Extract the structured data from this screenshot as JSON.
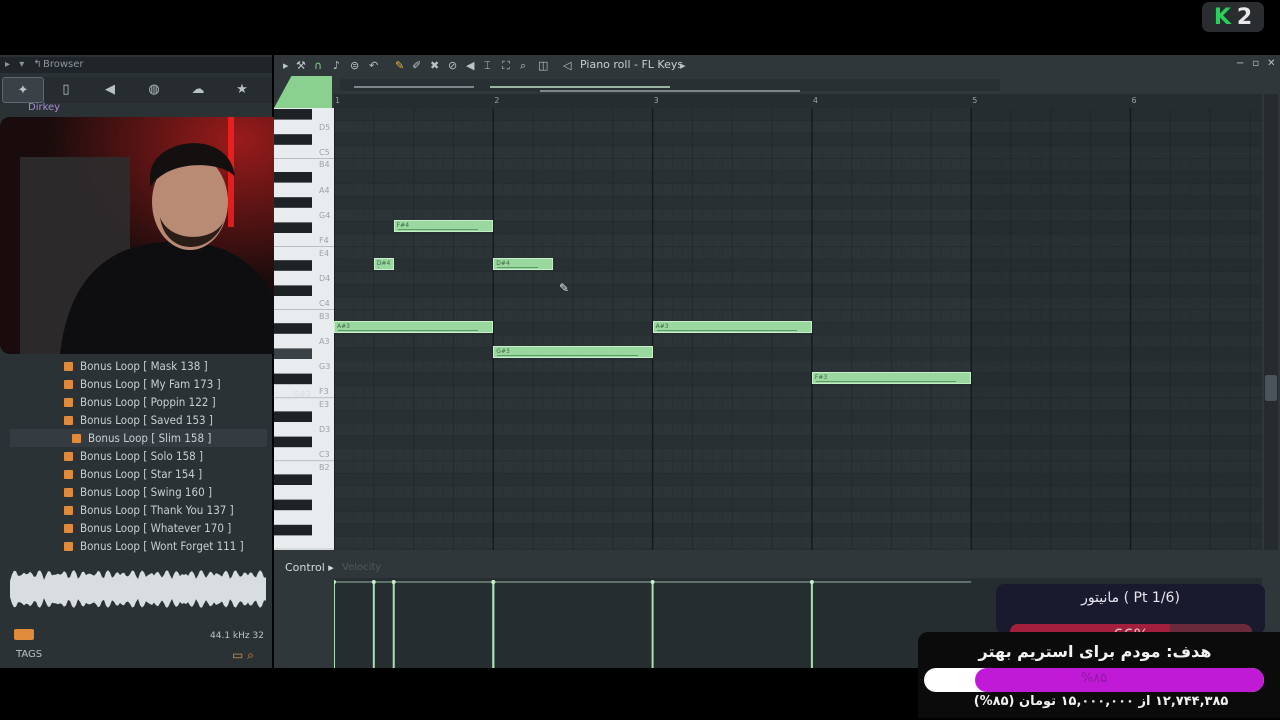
{
  "logo": {
    "k": "K",
    "two": "2"
  },
  "browser": {
    "title": "Browser",
    "tabs": [
      "all-icon",
      "file-icon",
      "speaker-icon",
      "globe-icon",
      "cloud-icon",
      "star-icon"
    ],
    "folder": "Dirkey",
    "files": [
      "Bonus Loop [ Mask 138 ]",
      "Bonus Loop [ My Fam 173 ]",
      "Bonus Loop [ Poppin 122 ]",
      "Bonus Loop [ Saved 153 ]",
      "Bonus Loop [ Slim 158 ]",
      "Bonus Loop [ Solo 158 ]",
      "Bonus Loop [ Star 154 ]",
      "Bonus Loop [ Swing 160 ]",
      "Bonus Loop [ Thank You 137 ]",
      "Bonus Loop [ Whatever 170 ]",
      "Bonus Loop [ Wont Forget 111 ]"
    ],
    "selected_file": "Bonus Loop [ Slim 158 ]",
    "sample_info": "44.1 kHz 32",
    "tags": "TAGS"
  },
  "piano_roll": {
    "title": "Piano roll - FL Keys",
    "bars": [
      "1",
      "2",
      "3",
      "4",
      "5",
      "6"
    ],
    "key_labels": [
      "D5",
      "C5",
      "B4",
      "A4",
      "G4",
      "F4",
      "E4",
      "D4",
      "C4",
      "B3",
      "A3",
      "G3",
      "F3",
      "E3",
      "D3",
      "C3",
      "B2"
    ],
    "hover_key": "G#3",
    "notes": [
      {
        "pitch": "F#4",
        "start": 1.375,
        "length": 0.625
      },
      {
        "pitch": "D#4",
        "start": 1.25,
        "length": 0.125
      },
      {
        "pitch": "D#4",
        "start": 2.0,
        "length": 0.375
      },
      {
        "pitch": "A#3",
        "start": 1.0,
        "length": 1.0
      },
      {
        "pitch": "A#3",
        "start": 3.0,
        "length": 1.0
      },
      {
        "pitch": "G#3",
        "start": 2.0,
        "length": 1.0
      },
      {
        "pitch": "F#3",
        "start": 4.0,
        "length": 1.0
      }
    ]
  },
  "control": {
    "label": "Control",
    "param": "Velocity"
  },
  "overlay": {
    "monitor_title": "مانیتور ( Pt 1/6)",
    "monitor_percent": "66%",
    "monitor_level": 0.66,
    "goal_title": "هدف: مودم برای استریم بهتر",
    "goal_percent": "%۸۵",
    "goal_level": 0.85,
    "goal_amount": "۱۲,۷۴۴,۳۸۵ از ۱۵,۰۰۰,۰۰۰ تومان (۸۵%)"
  },
  "colors": {
    "note": "#9ad8a0",
    "accent": "#e08a3c",
    "goal_fill": "#c11ad6"
  }
}
